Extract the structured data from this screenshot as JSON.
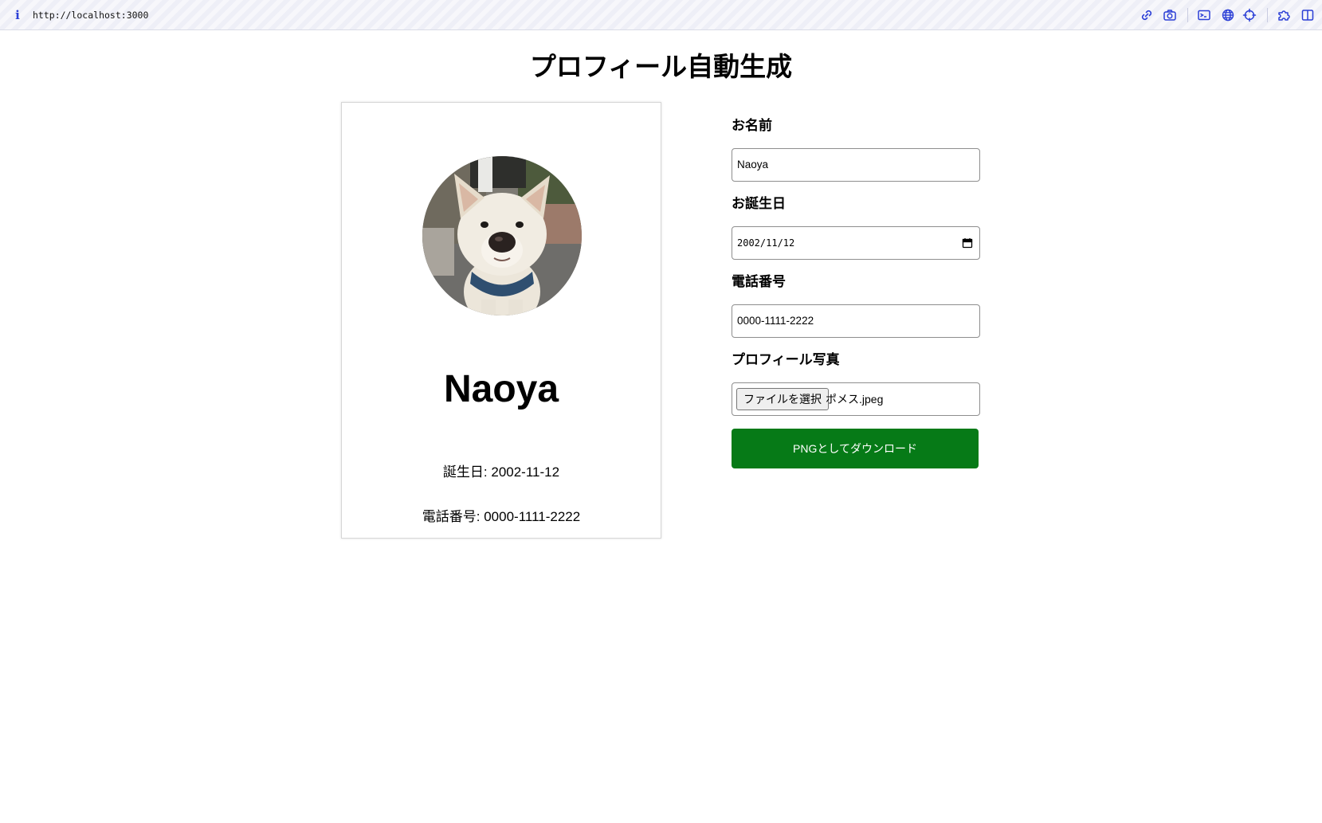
{
  "browser": {
    "url": "http://localhost:3000",
    "info_icon": "i",
    "toolbar_icons": [
      "link-icon",
      "camera-icon",
      "terminal-icon",
      "globe-icon",
      "crosshair-icon",
      "puzzle-icon",
      "split-view-icon"
    ],
    "accent_color": "#2b3fd6"
  },
  "page": {
    "title": "プロフィール自動生成"
  },
  "card": {
    "name": "Naoya",
    "birthday_line": "誕生日: 2002-11-12",
    "phone_line": "電話番号: 0000-1111-2222",
    "avatar": "dog-photo"
  },
  "form": {
    "name_label": "お名前",
    "name_value": "Naoya",
    "birthday_label": "お誕生日",
    "birthday_value": "2002/11/12",
    "phone_label": "電話番号",
    "phone_value": "0000-1111-2222",
    "photo_label": "プロフィール写真",
    "file_button_label": "ファイルを選択",
    "file_name": "ポメス.jpeg",
    "download_label": "PNGとしてダウンロード",
    "download_color": "#067a17"
  }
}
